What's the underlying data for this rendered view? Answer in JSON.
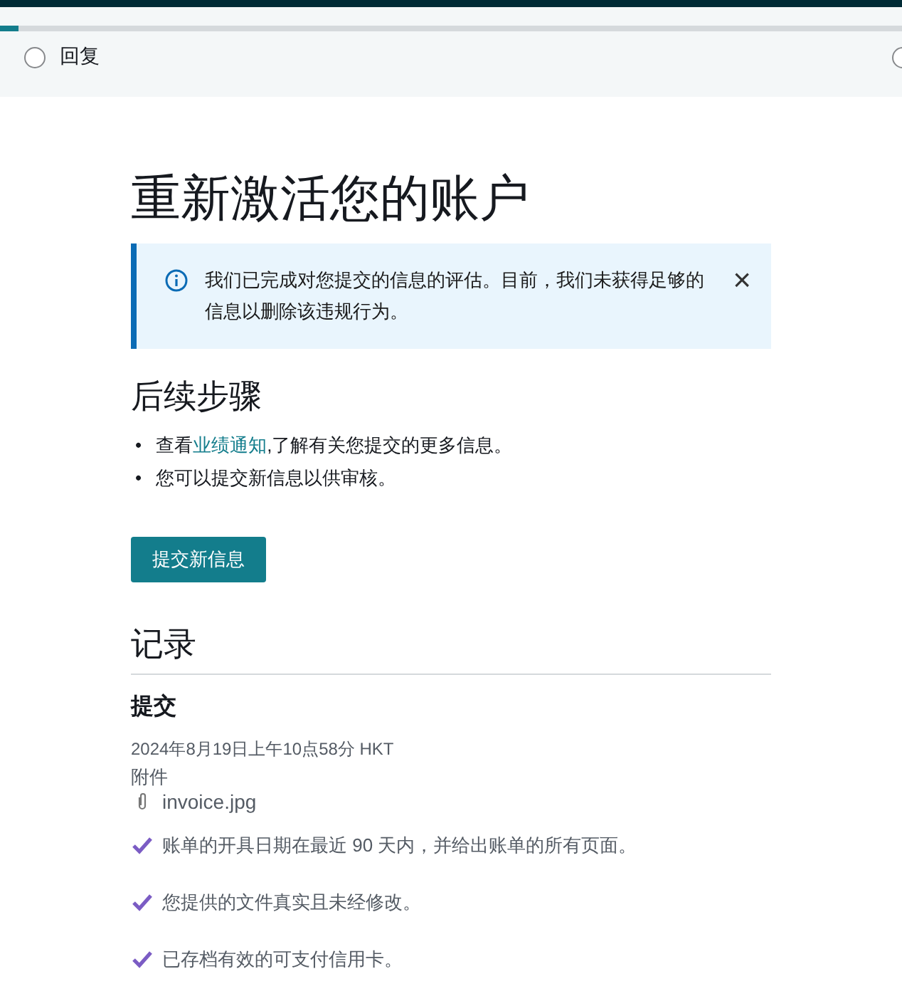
{
  "progress": {
    "level": 0.02
  },
  "steps": [
    {
      "label": "回复",
      "selected": false
    },
    {
      "selected": false
    }
  ],
  "title": "重新激活您的账户",
  "alert": {
    "kind": "info",
    "text": "我们已完成对您提交的信息的评估。目前，我们未获得足够的信息以删除该违规行为。",
    "close": "×"
  },
  "next_steps": {
    "heading": "后续步骤",
    "items": [
      {
        "marker": "•",
        "before": "查看",
        "link": "业绩通知",
        "after": ",了解有关您提交的更多信息。"
      },
      {
        "marker": "•",
        "before": "您可以提交新信息以供审核。"
      }
    ]
  },
  "submit_button": "提交新信息",
  "record": {
    "heading": "记录",
    "entry_title": "提交",
    "date": "2024年8月19日上午10点58分 HKT",
    "attachments_label": "附件",
    "attachment": "invoice.jpg",
    "checks": [
      {
        "text": "账单的开具日期在最近 90 天内，并给出账单的所有页面。",
        "checked": true
      },
      {
        "text": "您提供的文件真实且未经修改。",
        "checked": true
      },
      {
        "text": "已存档有效的可支付信用卡。",
        "checked": true
      }
    ]
  }
}
